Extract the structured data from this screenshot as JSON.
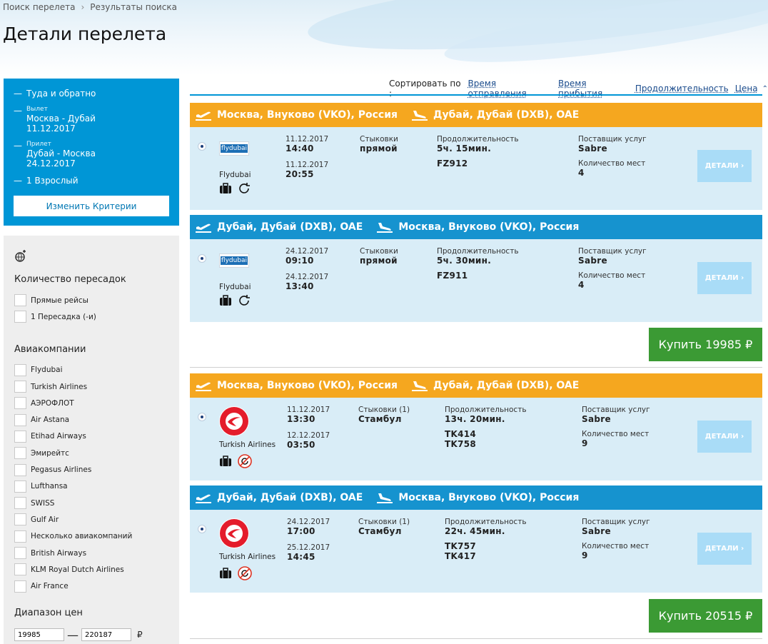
{
  "breadcrumbs": [
    "Поиск перелета",
    "Результаты поиска"
  ],
  "page_title": "Детали перелета",
  "summary": {
    "trip_type": "Туда и обратно",
    "out_label": "Вылет",
    "out_route": "Москва - Дубай",
    "out_date": "11.12.2017",
    "ret_label": "Прилет",
    "ret_route": "Дубай - Москва",
    "ret_date": "24.12.2017",
    "passengers": "1 Взрослый",
    "change_button": "Изменить Критерии"
  },
  "filters": {
    "stops_heading": "Количество пересадок",
    "stops": [
      "Прямые рейсы",
      "1 Пересадка (-и)"
    ],
    "airlines_heading": "Авиакомпании",
    "airlines": [
      "Flydubai",
      "Turkish Airlines",
      "АЭРОФЛОТ",
      "Air Astana",
      "Etihad Airways",
      "Эмирейтс",
      "Pegasus Airlines",
      "Lufthansa",
      "SWISS",
      "Gulf Air",
      "Несколько авиакомпаний",
      "British Airways",
      "KLM Royal Dutch Airlines",
      "Air France"
    ],
    "price_heading": "Диапазон цен",
    "price_min": "19985",
    "price_max": "220187",
    "currency": "₽"
  },
  "sort": {
    "label": "Сортировать по :",
    "options": [
      "Время отправления",
      "Время прибытия",
      "Продолжительность",
      "Цена"
    ],
    "caret": "⌃"
  },
  "labels": {
    "stops": "Стыковки",
    "duration": "Продолжительность",
    "provider": "Поставщик услуг",
    "seats": "Количество мест",
    "details": "ДЕТАЛИ ›"
  },
  "segments": [
    {
      "color": "#f5a71f",
      "from": "Москва, Внуково (VKO), Россия",
      "to": "Дубай, Дубай (DXB), OAE",
      "airline": "Flydubai",
      "dep_date": "11.12.2017",
      "dep_time": "14:40",
      "arr_date": "11.12.2017",
      "arr_time": "20:55",
      "stops_label": "Стыковки",
      "stops": "прямой",
      "duration": "5ч. 15мин.",
      "flights": "FZ912",
      "provider": "Sabre",
      "seats": "4"
    },
    {
      "color": "#1693cf",
      "from": "Дубай, Дубай (DXB), OAE",
      "to": "Москва, Внуково (VKO), Россия",
      "airline": "Flydubai",
      "dep_date": "24.12.2017",
      "dep_time": "09:10",
      "arr_date": "24.12.2017",
      "arr_time": "13:40",
      "stops_label": "Стыковки",
      "stops": "прямой",
      "duration": "5ч. 30мин.",
      "flights": "FZ911",
      "provider": "Sabre",
      "seats": "4"
    },
    {
      "color": "#f5a71f",
      "from": "Москва, Внуково (VKO), Россия",
      "to": "Дубай, Дубай (DXB), OAE",
      "airline": "Turkish Airlines",
      "dep_date": "11.12.2017",
      "dep_time": "13:30",
      "arr_date": "12.12.2017",
      "arr_time": "03:50",
      "stops_label": "Стыковки (1)",
      "stops": "Стамбул",
      "duration": "13ч. 20мин.",
      "flights": "TK414",
      "flights2": "TK758",
      "provider": "Sabre",
      "seats": "9"
    },
    {
      "color": "#1693cf",
      "from": "Дубай, Дубай (DXB), OAE",
      "to": "Москва, Внуково (VKO), Россия",
      "airline": "Turkish Airlines",
      "dep_date": "24.12.2017",
      "dep_time": "17:00",
      "arr_date": "25.12.2017",
      "arr_time": "14:45",
      "stops_label": "Стыковки (1)",
      "stops": "Стамбул",
      "duration": "22ч. 45мин.",
      "flights": "TK757",
      "flights2": "TK417",
      "provider": "Sabre",
      "seats": "9"
    }
  ],
  "offers": [
    {
      "buy_label": "Купить 19985 ₽"
    },
    {
      "buy_label": "Купить 20515 ₽"
    }
  ],
  "logo_text": {
    "flydubai": "flydubai"
  }
}
